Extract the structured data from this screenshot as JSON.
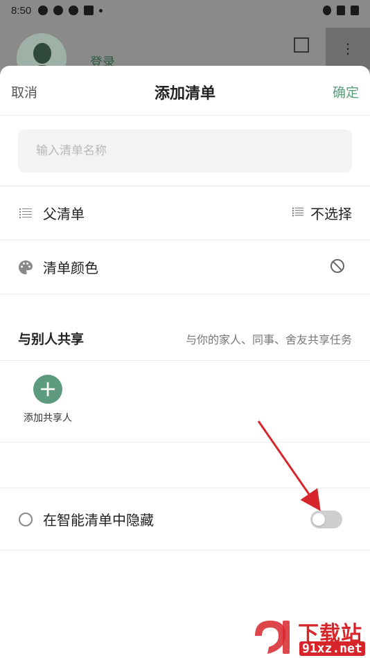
{
  "status_bar": {
    "time": "8:50"
  },
  "background": {
    "login_text": "登录"
  },
  "header": {
    "cancel_label": "取消",
    "title": "添加清单",
    "confirm_label": "确定"
  },
  "name_input": {
    "placeholder": "输入清单名称",
    "value": ""
  },
  "parent_list": {
    "label": "父清单",
    "value": "不选择"
  },
  "list_color": {
    "label": "清单颜色"
  },
  "share": {
    "title": "与别人共享",
    "description": "与你的家人、同事、舍友共享任务",
    "add_label": "添加共享人"
  },
  "hide_in_smart": {
    "label": "在智能清单中隐藏",
    "enabled": false
  },
  "colors": {
    "accent": "#5e9a7d",
    "arrow": "#d7262b"
  },
  "watermark": {
    "cn": "下载站",
    "en": "91xz.net"
  },
  "icons": [
    "list-outline-icon",
    "palette-icon",
    "no-color-icon",
    "plus-icon",
    "half-moon-icon",
    "scan-icon",
    "more-vert-icon"
  ]
}
